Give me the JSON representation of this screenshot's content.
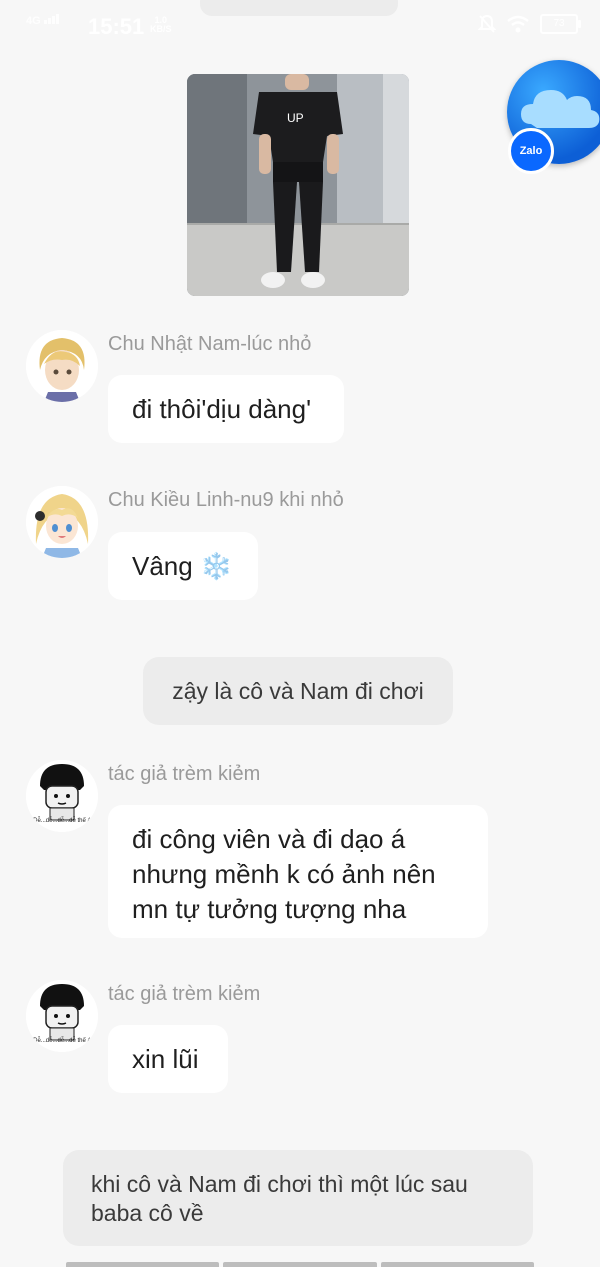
{
  "status_bar": {
    "network": "4G",
    "time": "15:51",
    "speed_value": "1.0",
    "speed_unit": "KB/S",
    "battery": "73"
  },
  "floating_app": {
    "label": "Zalo"
  },
  "messages": [
    {
      "sender": "Chu Nhật Nam-lúc nhỏ",
      "text": "đi thôi'dịu dàng'"
    },
    {
      "sender": "Chu Kiều Linh-nu9 khi nhỏ",
      "text": "Vâng ❄️"
    },
    {
      "narration": "zậy là cô và Nam đi chơi"
    },
    {
      "sender": "tác giả trèm kiẻm",
      "text": "đi công viên và đi dạo á\nnhưng mềnh k có ảnh nên\nmn tự tưởng tượng nha",
      "avatar_caption": "Dễ...dễ...dễ...dễ thế á"
    },
    {
      "sender": "tác giả trèm kiẻm",
      "text": "xin lũi",
      "avatar_caption": "Dễ...dễ...dễ...dễ thế á"
    },
    {
      "narration": "khi cô và Nam đi chơi thì một lúc sau\nbaba cô về"
    }
  ],
  "colors": {
    "background": "#f7f7f7",
    "bubble": "#ffffff",
    "narration": "#ececec",
    "sender_text": "#9a9a9a",
    "zalo_blue": "#0a68ff"
  }
}
